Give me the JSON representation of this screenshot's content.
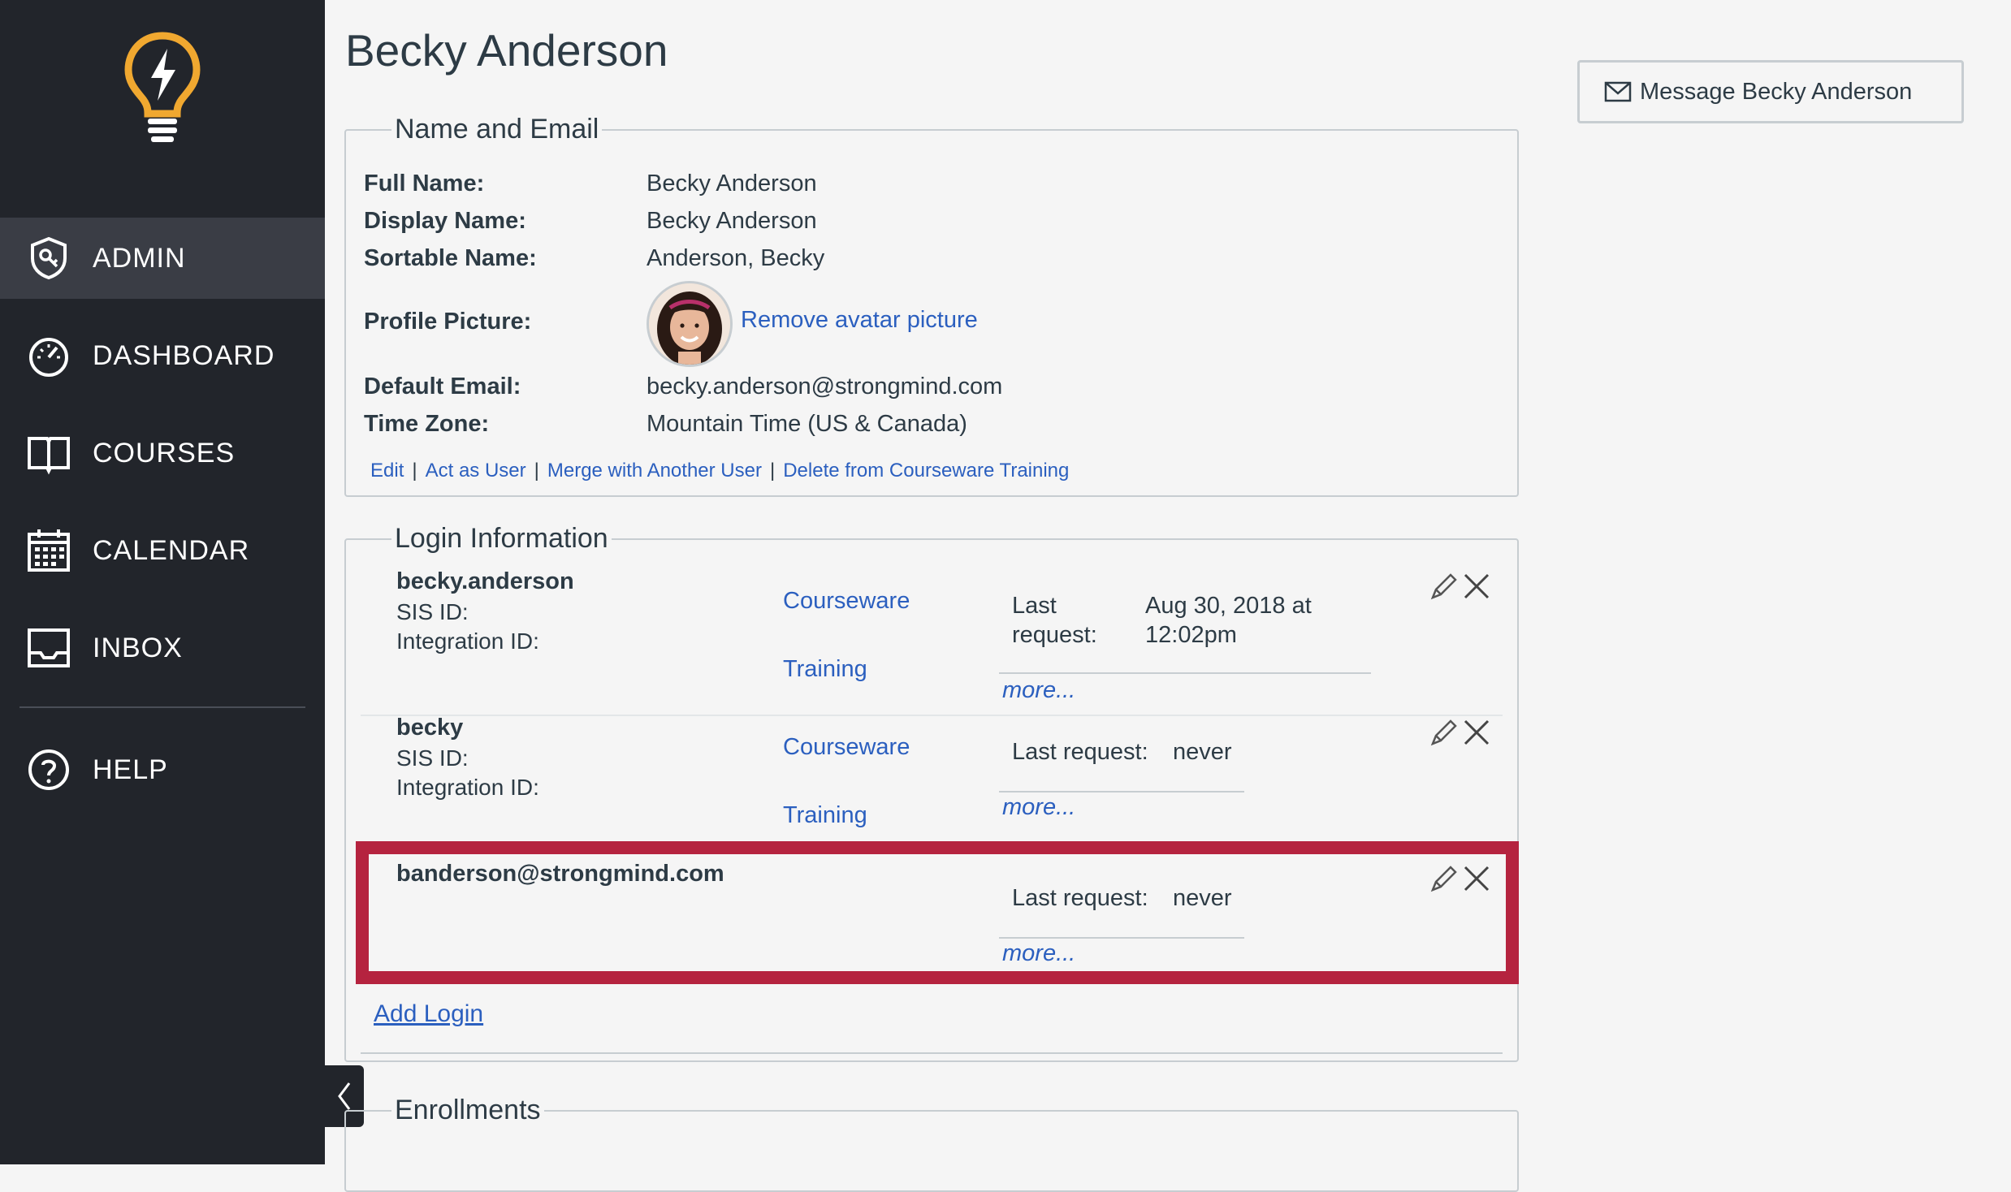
{
  "sidebar": {
    "items": [
      {
        "label": "ADMIN",
        "icon": "shield-key-icon",
        "active": true
      },
      {
        "label": "DASHBOARD",
        "icon": "speedometer-icon"
      },
      {
        "label": "COURSES",
        "icon": "book-icon"
      },
      {
        "label": "CALENDAR",
        "icon": "calendar-icon"
      },
      {
        "label": "INBOX",
        "icon": "inbox-icon"
      },
      {
        "label": "HELP",
        "icon": "help-icon"
      }
    ],
    "logo": "lightbulb-logo-icon",
    "accent": "#f0a830"
  },
  "page": {
    "title": "Becky Anderson",
    "message_button": "Message Becky Anderson"
  },
  "name_email": {
    "legend": "Name and Email",
    "fields": [
      {
        "label": "Full Name:",
        "value": "Becky Anderson"
      },
      {
        "label": "Display Name:",
        "value": "Becky Anderson"
      },
      {
        "label": "Sortable Name:",
        "value": "Anderson, Becky"
      },
      {
        "label": "Profile Picture:",
        "value": ""
      },
      {
        "label": "Default Email:",
        "value": "becky.anderson@strongmind.com"
      },
      {
        "label": "Time Zone:",
        "value": "Mountain Time (US & Canada)"
      }
    ],
    "remove_avatar": "Remove avatar picture",
    "actions": [
      "Edit",
      "Act as User",
      "Merge with Another User",
      "Delete from Courseware Training"
    ],
    "separator": "|"
  },
  "login_info": {
    "legend": "Login Information",
    "logins": [
      {
        "username": "becky.anderson",
        "sis": "SIS ID:",
        "integration": "Integration ID:",
        "account_line1": "Courseware",
        "account_line2": "Training",
        "last_request_label_1": "Last",
        "last_request_label_2": "request:",
        "last_request_value_1": "Aug 30, 2018 at",
        "last_request_value_2": "12:02pm",
        "more": "more..."
      },
      {
        "username": "becky",
        "sis": "SIS ID:",
        "integration": "Integration ID:",
        "account_line1": "Courseware",
        "account_line2": "Training",
        "last_request_label": "Last request:",
        "last_request_value": "never",
        "more": "more..."
      },
      {
        "username": "banderson@strongmind.com",
        "last_request_label": "Last request:",
        "last_request_value": "never",
        "more": "more...",
        "highlighted": true
      }
    ],
    "add_login": "Add Login",
    "highlight_color": "#b5233f"
  },
  "enrollments": {
    "legend": "Enrollments"
  }
}
